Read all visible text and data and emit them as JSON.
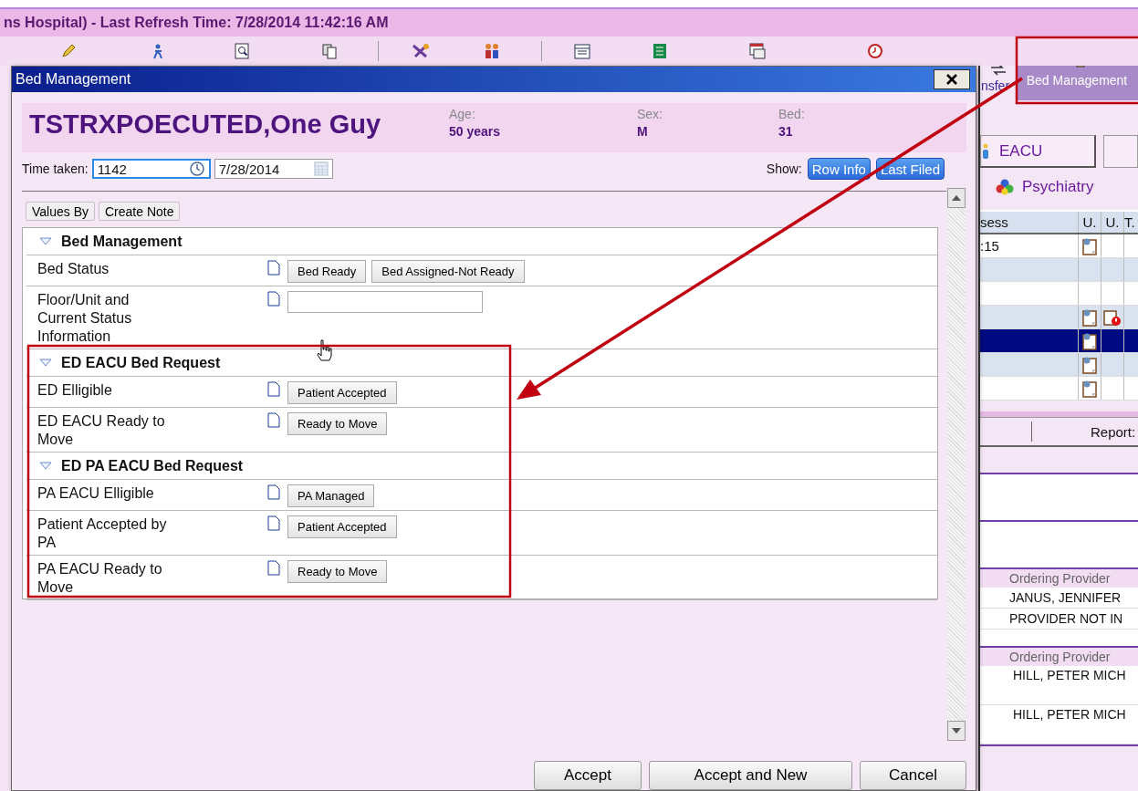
{
  "app_title": "ns Hospital) - Last Refresh Time: 7/28/2014 11:42:16 AM",
  "toolbar": {
    "transfer_label": "nsfer",
    "bed_management_button": {
      "label": "Bed Management",
      "selected": true
    }
  },
  "side_panel": {
    "tabs": [
      {
        "label": "EACU",
        "selected": false
      }
    ],
    "unit": "Psychiatry",
    "table": {
      "columns": [
        "sess",
        "U.",
        "U.",
        "T."
      ],
      "rows": [
        {
          "cell": ":15",
          "note": true,
          "alert": false,
          "selected": false
        },
        {
          "note": false,
          "alert": false,
          "selected": false
        },
        {
          "note": false,
          "alert": false,
          "selected": false
        },
        {
          "note": true,
          "alert": true,
          "selected": false
        },
        {
          "note": true,
          "alert": false,
          "selected": true
        },
        {
          "note": true,
          "alert": false,
          "selected": false
        },
        {
          "note": true,
          "alert": false,
          "selected": false
        }
      ]
    },
    "report_label": "Report:",
    "provider_groups": [
      {
        "heading": "Ordering Provider",
        "names": [
          "JANUS, JENNIFER",
          "PROVIDER NOT IN"
        ]
      },
      {
        "heading": "Ordering Provider",
        "names": [
          "HILL, PETER MICH",
          "HILL, PETER MICH"
        ]
      }
    ]
  },
  "dialog": {
    "title": "Bed Management",
    "patient": {
      "name": "TSTRXPOECUTED,One Guy",
      "facts": [
        {
          "label": "Age:",
          "value": "50 years"
        },
        {
          "label": "Sex:",
          "value": "M"
        },
        {
          "label": "Bed:",
          "value": "31"
        }
      ]
    },
    "time_label": "Time taken:",
    "time_value": "1142",
    "date_value": "7/28/2014",
    "show_label": "Show:",
    "show_buttons": [
      {
        "label": "Row Info",
        "on": true
      },
      {
        "label": "Last Filed",
        "on": true
      }
    ],
    "tool_buttons": [
      "Values By",
      "Create Note"
    ],
    "sections": [
      {
        "title": "Bed Management",
        "expanded": true,
        "rows": [
          {
            "label": "Bed Status",
            "kind": "buttons",
            "buttons": [
              "Bed Ready",
              "Bed Assigned-Not Ready"
            ]
          },
          {
            "label": "Floor/Unit and Current Status Information",
            "kind": "field"
          }
        ]
      },
      {
        "title": "ED EACU Bed Request",
        "expanded": true,
        "rows": [
          {
            "label": "ED Elligible",
            "kind": "buttons",
            "buttons": [
              "Patient Accepted"
            ]
          },
          {
            "label": "ED EACU Ready to Move",
            "kind": "buttons",
            "buttons": [
              "Ready to Move"
            ]
          }
        ]
      },
      {
        "title": "ED PA EACU Bed Request",
        "expanded": true,
        "rows": [
          {
            "label": "PA EACU Elligible",
            "kind": "buttons",
            "buttons": [
              "PA Managed"
            ]
          },
          {
            "label": "Patient Accepted by PA",
            "kind": "buttons",
            "buttons": [
              "Patient Accepted"
            ]
          },
          {
            "label": "PA EACU Ready to Move",
            "kind": "buttons",
            "buttons": [
              "Ready to Move"
            ]
          }
        ]
      }
    ],
    "footer_buttons": [
      "Accept",
      "Accept and New",
      "Cancel"
    ]
  }
}
